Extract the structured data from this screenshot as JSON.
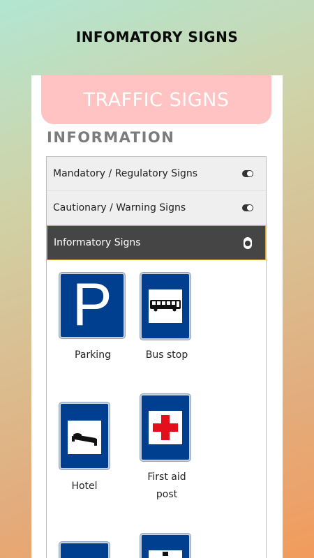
{
  "header": {
    "title": "INFOMATORY SIGNS"
  },
  "banner": {
    "title": "TRAFFIC SIGNS"
  },
  "section": {
    "title": "INFORMATION"
  },
  "accordion": {
    "items": [
      {
        "label": "Mandatory / Regulatory Signs",
        "active": false
      },
      {
        "label": "Cautionary / Warning Signs",
        "active": false
      },
      {
        "label": "Informatory Signs",
        "active": true
      }
    ]
  },
  "signs": [
    {
      "label": "Parking",
      "icon": "parking-sign-icon",
      "glyph": "P"
    },
    {
      "label": "Bus stop",
      "icon": "bus-stop-sign-icon"
    },
    {
      "label": "Hotel",
      "icon": "hotel-sign-icon"
    },
    {
      "label_line1": "First aid",
      "label_line2": "post",
      "icon": "first-aid-sign-icon"
    }
  ],
  "colors": {
    "sign_blue": "#003f8f",
    "banner_pink": "#fec3c2",
    "active_row": "#454545",
    "cross_red": "#e3101c"
  }
}
